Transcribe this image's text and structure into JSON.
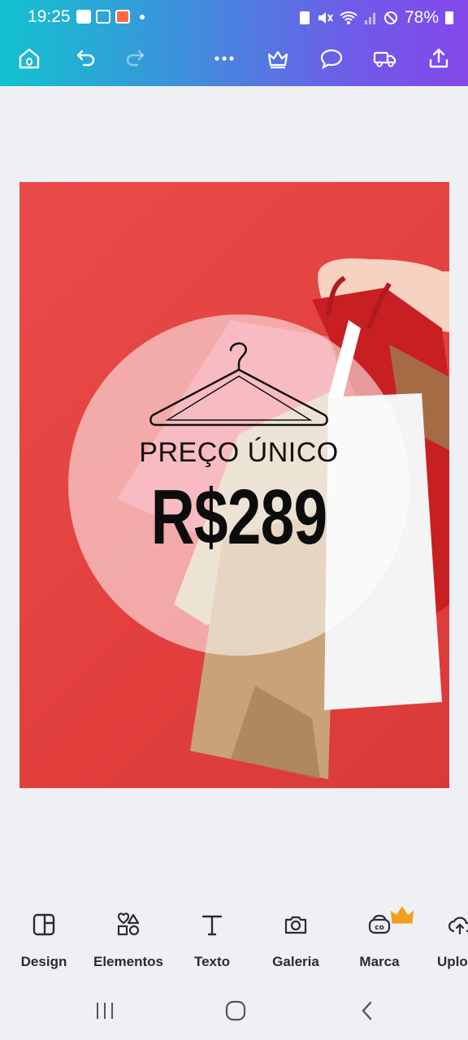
{
  "status": {
    "time": "19:25",
    "battery": "78%"
  },
  "design": {
    "headline": "PREÇO ÚNICO",
    "price": "R$289"
  },
  "tools": [
    {
      "label": "Design"
    },
    {
      "label": "Elementos"
    },
    {
      "label": "Texto"
    },
    {
      "label": "Galeria"
    },
    {
      "label": "Marca"
    },
    {
      "label": "Uplo"
    }
  ],
  "colors": {
    "accent_start": "#12c2cf",
    "accent_end": "#8447ea",
    "design_bg": "#e23f3d",
    "crown": "#f0a020"
  }
}
